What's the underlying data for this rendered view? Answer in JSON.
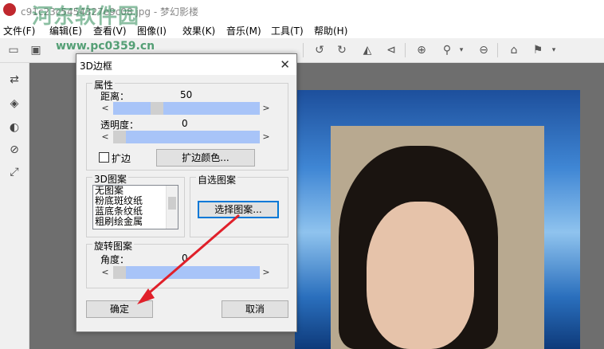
{
  "window": {
    "title": "c91c23c5454327e9c08.jpg - 梦幻影楼"
  },
  "watermark": {
    "text": "河东软件园",
    "url": "www.pc0359.cn"
  },
  "menu": [
    {
      "label": "文件(F)"
    },
    {
      "label": "编辑(E)"
    },
    {
      "label": "查看(V)"
    },
    {
      "label": "图像(I)"
    },
    {
      "label": "效果(K)"
    },
    {
      "label": "音乐(M)"
    },
    {
      "label": "工具(T)"
    },
    {
      "label": "帮助(H)"
    }
  ],
  "toolbar_icons": [
    "open-icon",
    "save-icon",
    "rotate-left-icon",
    "rotate-right-icon",
    "flip-horizontal-icon",
    "flip-vertical-icon",
    "zoom-in-icon",
    "zoom-icon",
    "zoom-out-icon",
    "home-icon",
    "flag-icon"
  ],
  "sidebar_icons": [
    "swap-icon",
    "layers-icon",
    "mask-icon",
    "erase-icon",
    "crop-icon"
  ],
  "dialog": {
    "title": "3D边框",
    "properties": {
      "label": "属性",
      "distance_label": "距离：",
      "distance_value": "50",
      "distance_fraction": 0.28,
      "opacity_label": "透明度：",
      "opacity_value": "0",
      "opacity_fraction": 0.0,
      "extend_label": "扩边",
      "extend_checked": false,
      "extend_color_button": "扩边颜色..."
    },
    "pattern_3d": {
      "label": "3D图案",
      "items": [
        "无图案",
        "粉底斑纹纸",
        "蓝底条纹纸",
        "粗刷绘金属"
      ]
    },
    "custom_pattern": {
      "label": "自选图案",
      "button": "选择图案..."
    },
    "rotate_pattern": {
      "label": "旋转图案",
      "angle_label": "角度：",
      "angle_value": "0",
      "angle_fraction": 0.0
    },
    "ok_button": "确定",
    "cancel_button": "取消"
  },
  "colors": {
    "accent": "#0078d7",
    "slider_track": "#a8c4f8",
    "arrow": "#e0202a"
  }
}
